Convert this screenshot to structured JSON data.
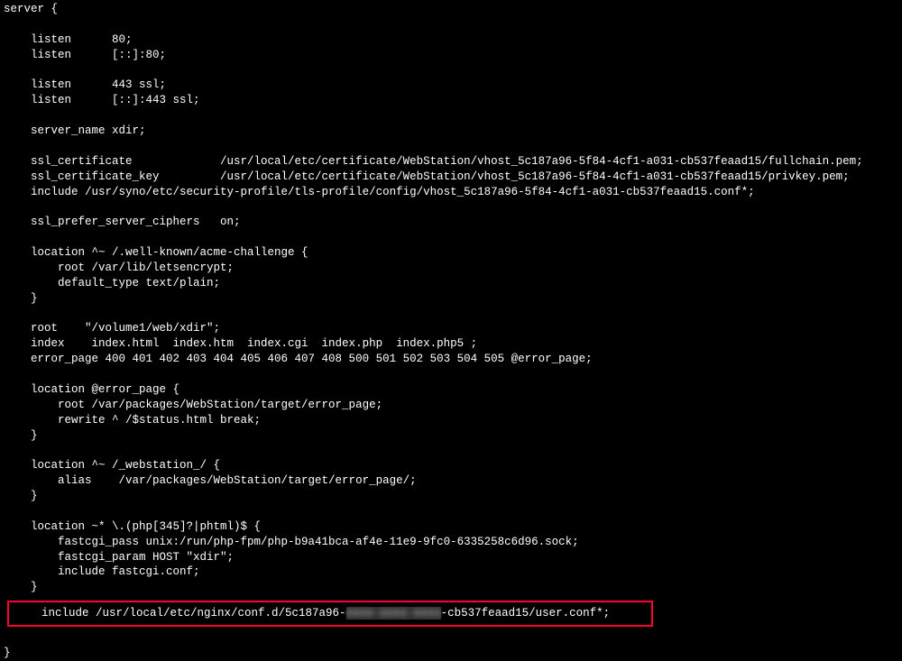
{
  "config": {
    "server_open": "server {",
    "listen80": "    listen      80;",
    "listen80v6": "    listen      [::]:80;",
    "listen443": "    listen      443 ssl;",
    "listen443v6": "    listen      [::]:443 ssl;",
    "server_name": "    server_name xdir;",
    "ssl_cert": "    ssl_certificate             /usr/local/etc/certificate/WebStation/vhost_5c187a96-5f84-4cf1-a031-cb537feaad15/fullchain.pem;",
    "ssl_key": "    ssl_certificate_key         /usr/local/etc/certificate/WebStation/vhost_5c187a96-5f84-4cf1-a031-cb537feaad15/privkey.pem;",
    "include_sec": "    include /usr/syno/etc/security-profile/tls-profile/config/vhost_5c187a96-5f84-4cf1-a031-cb537feaad15.conf*;",
    "ssl_ciphers": "    ssl_prefer_server_ciphers   on;",
    "loc_acme_open": "    location ^~ /.well-known/acme-challenge {",
    "loc_acme_root": "        root /var/lib/letsencrypt;",
    "loc_acme_type": "        default_type text/plain;",
    "loc_close": "    }",
    "root": "    root    \"/volume1/web/xdir\";",
    "index": "    index    index.html  index.htm  index.cgi  index.php  index.php5 ;",
    "error_page": "    error_page 400 401 402 403 404 405 406 407 408 500 501 502 503 504 505 @error_page;",
    "loc_err_open": "    location @error_page {",
    "loc_err_root": "        root /var/packages/WebStation/target/error_page;",
    "loc_err_rewrite": "        rewrite ^ /$status.html break;",
    "loc_ws_open": "    location ^~ /_webstation_/ {",
    "loc_ws_alias": "        alias    /var/packages/WebStation/target/error_page/;",
    "loc_php_open": "    location ~* \\.(php[345]?|phtml)$ {",
    "loc_php_pass": "        fastcgi_pass unix:/run/php-fpm/php-b9a41bca-af4e-11e9-9fc0-6335258c6d96.sock;",
    "loc_php_param": "        fastcgi_param HOST \"xdir\";",
    "loc_php_inc": "        include fastcgi.conf;",
    "include_user_prefix": "    include /usr/local/etc/nginx/conf.d/5c187a96-",
    "include_user_redacted": "xxxx-xxxx-xxxx",
    "include_user_suffix": "-cb537feaad15/user.conf*;",
    "server_close": "}"
  }
}
